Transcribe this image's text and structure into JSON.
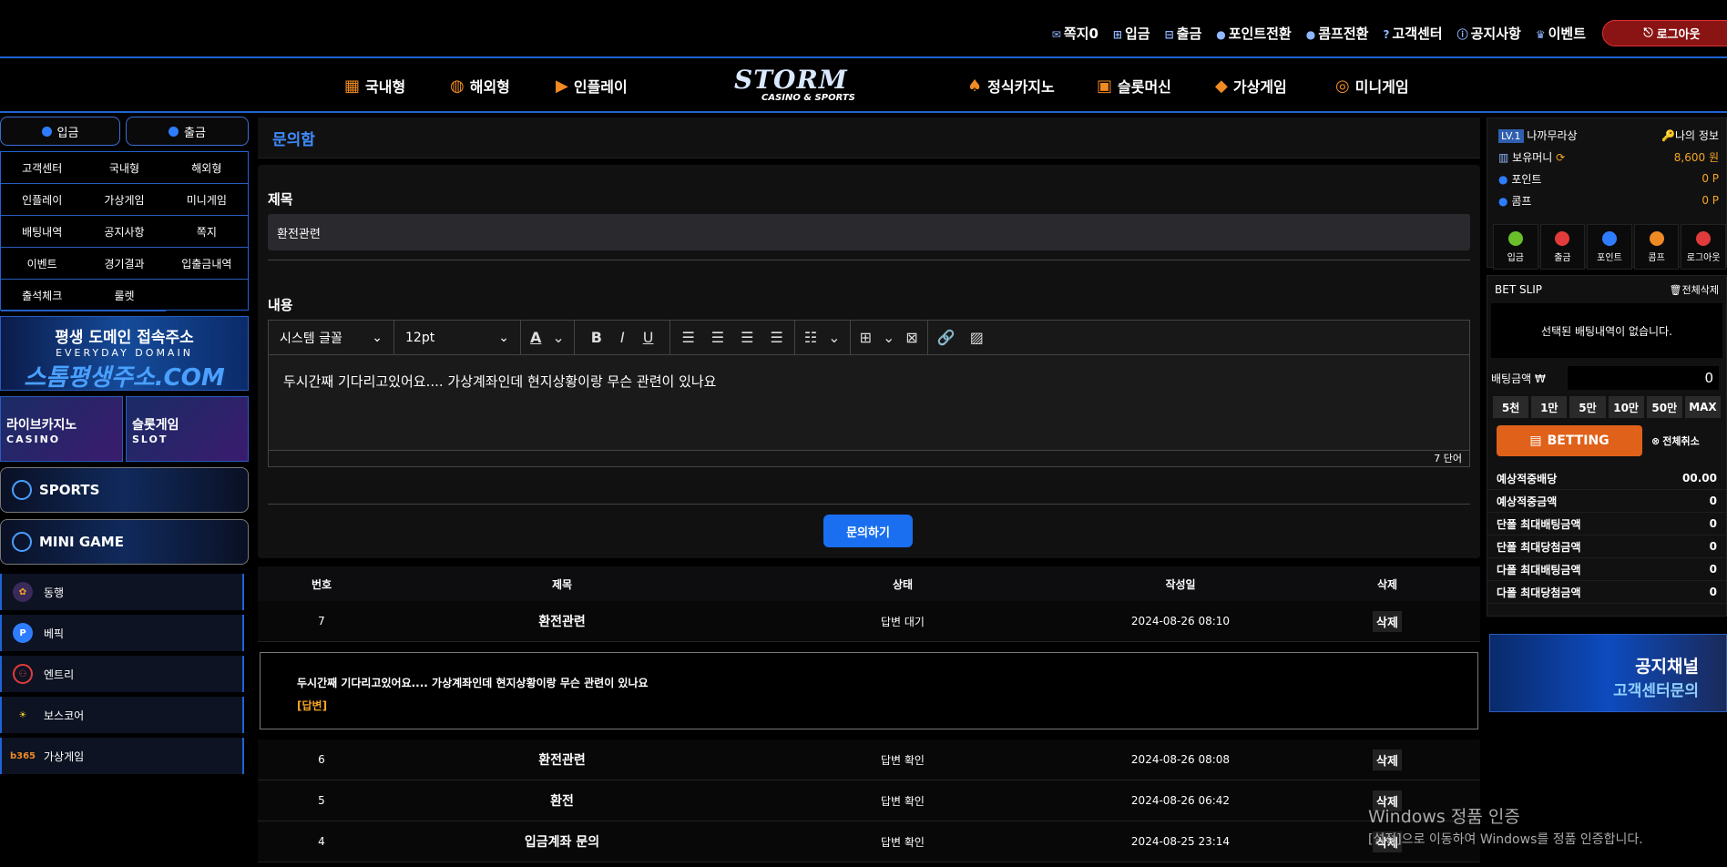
{
  "topbar": {
    "links": [
      {
        "icon": "mail-icon",
        "label": "쪽지0"
      },
      {
        "icon": "plus-square-icon",
        "label": "입금"
      },
      {
        "icon": "minus-square-icon",
        "label": "출금"
      },
      {
        "icon": "point-icon",
        "label": "포인트전환"
      },
      {
        "icon": "comp-icon",
        "label": "콤프전환"
      },
      {
        "icon": "question-icon",
        "label": "고객센터"
      },
      {
        "icon": "info-icon",
        "label": "공지사항"
      },
      {
        "icon": "gift-icon",
        "label": "이벤트"
      }
    ],
    "logout_label": "로그아웃"
  },
  "mainnav": {
    "left": [
      "국내형",
      "해외형",
      "인플레이"
    ],
    "right": [
      "정식카지노",
      "슬롯머신",
      "가상게임",
      "미니게임"
    ],
    "logo_main": "STORM",
    "logo_sub": "CASINO & SPORTS"
  },
  "sidebar": {
    "deposit": "입금",
    "withdraw": "출금",
    "menu": [
      "고객센터",
      "국내형",
      "해외형",
      "인플레이",
      "가상게임",
      "미니게임",
      "배팅내역",
      "공지사항",
      "쪽지",
      "이벤트",
      "경기결과",
      "입출금내역",
      "출석체크",
      "룰렛"
    ],
    "domain_banner": {
      "line1": "평생 도메인 접속주소",
      "line2": "EVERYDAY DOMAIN",
      "line3": "스톰평생주소.COM"
    },
    "casino_banner": {
      "title": "라이브카지노",
      "sub": "CASINO"
    },
    "slot_banner": {
      "title": "슬롯게임",
      "sub": "SLOT"
    },
    "sports_banner": "SPORTS",
    "minigame_banner": "MINI GAME",
    "games": [
      {
        "label": "동행",
        "icon": "donghaeng-icon"
      },
      {
        "label": "베픽",
        "icon": "bepick-icon"
      },
      {
        "label": "엔트리",
        "icon": "entry-icon"
      },
      {
        "label": "보스코어",
        "icon": "boscore-icon"
      },
      {
        "label": "가상게임",
        "icon": "bet365-icon"
      }
    ]
  },
  "page": {
    "title": "문의함",
    "subject_label": "제목",
    "subject_value": "환전관련",
    "content_label": "내용",
    "editor": {
      "font": "시스템 글꼴",
      "size": "12pt",
      "body": "두시간째 기다리고있어요.... 가상계좌인데 현지상황이랑 무슨 관련이 있나요",
      "wordcount": "7 단어"
    },
    "submit_label": "문의하기"
  },
  "table": {
    "headers": [
      "번호",
      "제목",
      "상태",
      "작성일",
      "삭제"
    ],
    "rows": [
      {
        "no": "7",
        "title": "환전관련",
        "status": "답변 대기",
        "date": "2024-08-26 08:10",
        "del": "삭제"
      },
      {
        "no": "6",
        "title": "환전관련",
        "status": "답변 확인",
        "date": "2024-08-26 08:08",
        "del": "삭제"
      },
      {
        "no": "5",
        "title": "환전",
        "status": "답변 확인",
        "date": "2024-08-26 06:42",
        "del": "삭제"
      },
      {
        "no": "4",
        "title": "입금계좌 문의",
        "status": "답변 확인",
        "date": "2024-08-25 23:14",
        "del": "삭제"
      }
    ],
    "expanded": {
      "content": "두시간째 기다리고있어요.... 가상계좌인데 현지상황이랑 무슨 관련이 있나요",
      "reply": "[답변]"
    }
  },
  "rightpanel": {
    "level": "LV.1",
    "username": "나까무라상",
    "my_info": "나의  정보",
    "money_label": "보유머니",
    "money_value": "8,600 원",
    "point_label": "포인트",
    "point_value": "0 P",
    "comp_label": "콤프",
    "comp_value": "0 P",
    "quick": [
      {
        "label": "입금",
        "color": "#6bbf2a"
      },
      {
        "label": "출금",
        "color": "#e23b3b"
      },
      {
        "label": "포인트",
        "color": "#2f7dff"
      },
      {
        "label": "콤프",
        "color": "#f08a24"
      },
      {
        "label": "로그아웃",
        "color": "#e23b3b"
      }
    ],
    "betslip_label": "BET SLIP",
    "clear_all_label": "전체삭제",
    "betslip_empty": "선택된 배팅내역이 없습니다.",
    "bet_amount_label": "배팅금액",
    "bet_amount_value": "0",
    "chips": [
      "5천",
      "1만",
      "5만",
      "10만",
      "50만",
      "MAX"
    ],
    "betting_label": "BETTING",
    "cancel_all_label": "전체취소",
    "info": [
      {
        "label": "예상적중배당",
        "value": "00.00"
      },
      {
        "label": "예상적중금액",
        "value": "0"
      },
      {
        "label": "단폴 최대배팅금액",
        "value": "0"
      },
      {
        "label": "단폴 최대당첨금액",
        "value": "0"
      },
      {
        "label": "다폴 최대배팅금액",
        "value": "0"
      },
      {
        "label": "다폴 최대당첨금액",
        "value": "0"
      }
    ],
    "ad": {
      "line1": "공지채널",
      "line2": "고객센터문의"
    }
  },
  "watermark": {
    "line1": "Windows 정품 인증",
    "line2": "[설정]으로 이동하여 Windows를 정품 인증합니다."
  }
}
